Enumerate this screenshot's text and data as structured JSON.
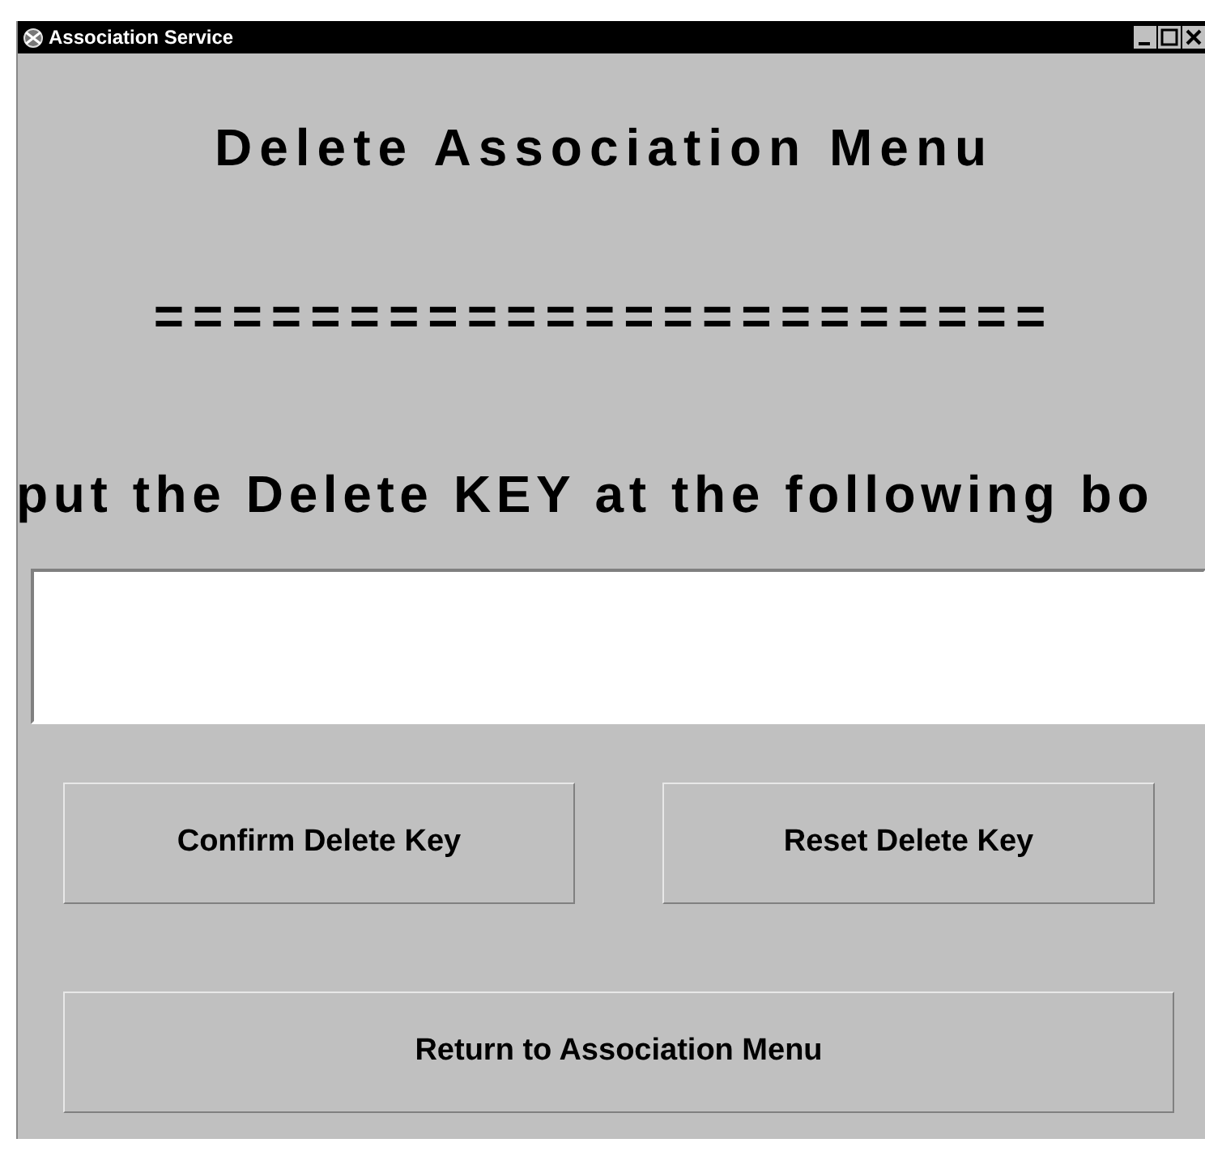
{
  "window": {
    "title": "Association Service"
  },
  "heading": "Delete Association Menu",
  "separator": "=======================",
  "instruction": "put the Delete KEY at the following bo",
  "buttons": [
    {
      "label": "Confirm Delete Key",
      "kind": "half"
    },
    {
      "label": "Reset Delete Key",
      "kind": "half"
    },
    {
      "label": "Return to Association Menu",
      "kind": "full"
    }
  ]
}
